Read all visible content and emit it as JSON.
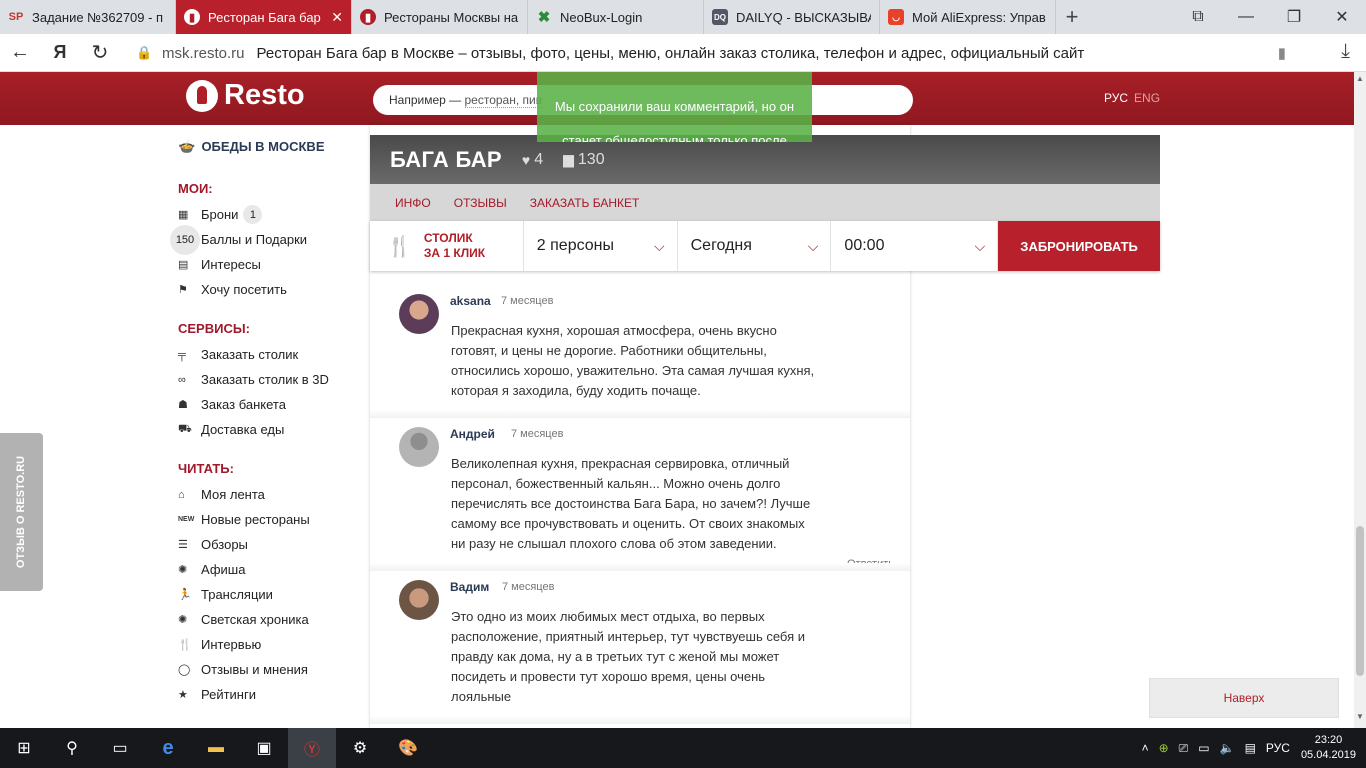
{
  "browser": {
    "tabs": [
      {
        "favicon": "SP",
        "title": "Задание №362709 - п",
        "active": false
      },
      {
        "favicon": "resto-icon",
        "title": "Ресторан Бага бар",
        "active": true
      },
      {
        "favicon": "resto-icon",
        "title": "Рестораны Москвы на",
        "active": false
      },
      {
        "favicon": "neobux-icon",
        "title": "NeoBux-Login",
        "active": false
      },
      {
        "favicon": "DQ",
        "title": "DAILYQ - ВЫСКАЗЫВАН",
        "active": false
      },
      {
        "favicon": "aliexpress-icon",
        "title": "Мой AliExpress: Управ",
        "active": false
      }
    ],
    "new_tab": "+",
    "address": {
      "host": "msk.resto.ru",
      "page_title": "Ресторан Бага бар в Москве – отзывы, фото, цены, меню, онлайн заказ столика, телефон и адрес, официальный сайт"
    },
    "yandex_button": "Я"
  },
  "site": {
    "logo": "Resto",
    "search_placeholder_prefix": "Например —",
    "search_examples": "ресторан, пив",
    "lang_ru": "РУС",
    "lang_en": "ENG",
    "notice": "Мы сохранили ваш комментарий, но он станет общедоступным только после"
  },
  "sidebar": {
    "lunch": "ОБЕДЫ В МОСКВЕ",
    "mine_title": "МОИ:",
    "mine": [
      {
        "label": "Брони",
        "badge": "1",
        "icon": "calendar-icon"
      },
      {
        "label": "Баллы и Подарки",
        "points": "150"
      },
      {
        "label": "Интересы",
        "icon": "document-icon"
      },
      {
        "label": "Хочу посетить",
        "icon": "flag-icon"
      }
    ],
    "services_title": "СЕРВИСЫ:",
    "services": [
      {
        "label": "Заказать столик",
        "icon": "table-icon"
      },
      {
        "label": "Заказать столик в 3D",
        "icon": "glasses-icon"
      },
      {
        "label": "Заказ банкета",
        "icon": "people-icon"
      },
      {
        "label": "Доставка еды",
        "icon": "delivery-icon"
      }
    ],
    "read_title": "ЧИТАТЬ:",
    "read": [
      {
        "label": "Моя лента",
        "icon": "home-icon"
      },
      {
        "label": "Новые рестораны",
        "icon": "new-icon",
        "icon_text": "NEW"
      },
      {
        "label": "Обзоры",
        "icon": "list-icon"
      },
      {
        "label": "Афиша",
        "icon": "sparkle-icon"
      },
      {
        "label": "Трансляции",
        "icon": "runner-icon"
      },
      {
        "label": "Светская хроника",
        "icon": "sparkle-icon"
      },
      {
        "label": "Интервью",
        "icon": "cutlery-icon"
      },
      {
        "label": "Отзывы и мнения",
        "icon": "speech-bubble-icon"
      },
      {
        "label": "Рейтинги",
        "icon": "star-icon"
      }
    ]
  },
  "feedback_tab": "ОТЗЫВ О RESTO.RU",
  "restaurant": {
    "name": "БАГА БАР",
    "likes": "4",
    "comments": "130",
    "nav": [
      "ИНФО",
      "ОТЗЫВЫ",
      "ЗАКАЗАТЬ БАНКЕТ"
    ]
  },
  "booking": {
    "quick_line1": "СТОЛИК",
    "quick_line2": "ЗА 1 КЛИК",
    "persons": "2 персоны",
    "date": "Сегодня",
    "time": "00:00",
    "submit": "ЗАБРОНИРОВАТЬ"
  },
  "reviews": [
    {
      "author": "aksana",
      "time": "7 месяцев",
      "text": "Прекрасная кухня, хорошая атмосфера, очень вкусно готовят, и цены не дорогие. Работники общительны, относились хорошо, уважительно. Эта самая лучшая кухня, которая я заходила, буду ходить почаще."
    },
    {
      "author": "Андрей",
      "time": "7 месяцев",
      "text": "Великолепная кухня, прекрасная сервировка, отличный персонал, божественный кальян... Можно очень долго перечислять все достоинства Бага Бара, но зачем?! Лучше самому все прочувствовать и оценить. От своих знакомых ни разу не слышал плохого слова об этом заведении.",
      "reply": "Ответить"
    },
    {
      "author": "Вадим",
      "time": "7 месяцев",
      "text": "Это одно из моих любимых мест отдыха, во первых расположение, приятный интерьер, тут чувствуешь себя и правду как дома, ну а в третьих тут с женой мы может посидеть и провести тут хорошо время, цены очень лояльные"
    }
  ],
  "to_top": "Наверх",
  "taskbar": {
    "lang": "РУС",
    "time": "23:20",
    "date": "05.04.2019"
  },
  "colors": {
    "brand_red": "#b8202b",
    "dark_header": "#4a4a4a",
    "notice_green": "#5ab248"
  }
}
